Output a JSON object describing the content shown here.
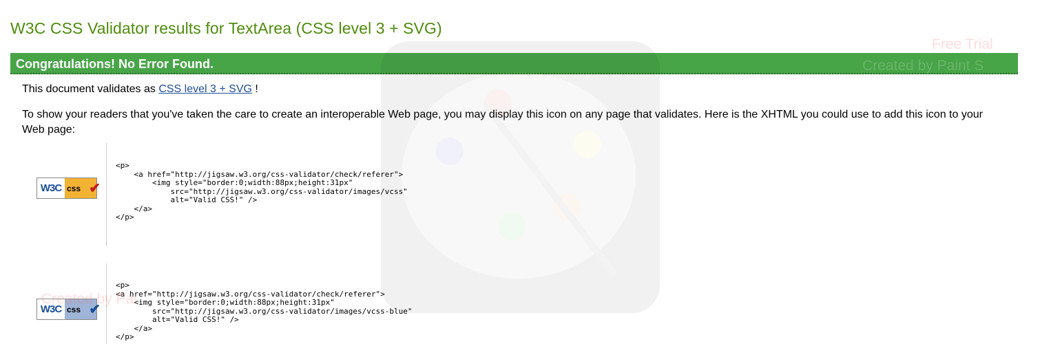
{
  "page": {
    "title": "W3C CSS Validator results for TextArea (CSS level 3 + SVG)",
    "banner_text": "Congratulations! No Error Found."
  },
  "intro": {
    "prefix": "This document validates as ",
    "link_text": "CSS level 3 + SVG",
    "suffix": " !"
  },
  "explanation": "To show your readers that you've taken the care to create an interoperable Web page, you may display this icon on any page that validates. Here is the XHTML you could use to add this icon to your Web page:",
  "badges": [
    {
      "w3c": "W3C",
      "css": "css",
      "check": "✔",
      "code": "<p>\n    <a href=\"http://jigsaw.w3.org/css-validator/check/referer\">\n        <img style=\"border:0;width:88px;height:31px\"\n            src=\"http://jigsaw.w3.org/css-validator/images/vcss\"\n            alt=\"Valid CSS!\" />\n    </a>\n</p>"
    },
    {
      "w3c": "W3C",
      "css": "css",
      "check": "✔",
      "code": "<p>\n<a href=\"http://jigsaw.w3.org/css-validator/check/referer\">\n    <img style=\"border:0;width:88px;height:31px\"\n        src=\"http://jigsaw.w3.org/css-validator/images/vcss-blue\"\n        alt=\"Valid CSS!\" />\n    </a>\n</p>"
    }
  ],
  "watermark": {
    "line1": "Free Trial",
    "line2": "Created by Paint S",
    "line3": "Created by Pai"
  }
}
